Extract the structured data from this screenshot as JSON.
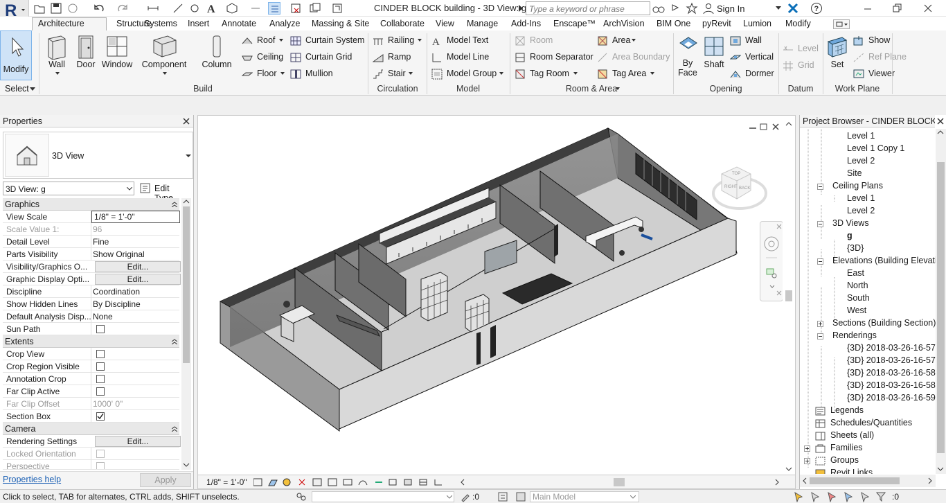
{
  "app": {
    "window_title": "CINDER BLOCK building - 3D View: g",
    "search_placeholder": "Type a keyword or phrase",
    "sign_in": "Sign In"
  },
  "tabs": [
    "Architecture",
    "Structure",
    "Systems",
    "Insert",
    "Annotate",
    "Analyze",
    "Massing & Site",
    "Collaborate",
    "View",
    "Manage",
    "Add-Ins",
    "Enscape™",
    "ArchVision",
    "BIM One",
    "pyRevit",
    "Lumion",
    "Modify"
  ],
  "ribbon": {
    "select": {
      "modify": "Modify",
      "select": "Select"
    },
    "build": {
      "panel": "Build",
      "wall": "Wall",
      "door": "Door",
      "window": "Window",
      "component": "Component",
      "column": "Column",
      "roof": "Roof",
      "ceiling": "Ceiling",
      "floor": "Floor",
      "curtain_system": "Curtain System",
      "curtain_grid": "Curtain Grid",
      "mullion": "Mullion"
    },
    "circulation": {
      "panel": "Circulation",
      "railing": "Railing",
      "ramp": "Ramp",
      "stair": "Stair"
    },
    "model": {
      "panel": "Model",
      "model_text": "Model Text",
      "model_line": "Model Line",
      "model_group": "Model Group"
    },
    "room_area": {
      "panel": "Room & Area",
      "room": "Room",
      "room_separator": "Room Separator",
      "tag_room": "Tag Room",
      "area": "Area",
      "area_boundary": "Area Boundary",
      "tag_area": "Tag Area"
    },
    "opening": {
      "panel": "Opening",
      "by_face_1": "By",
      "by_face_2": "Face",
      "shaft": "Shaft",
      "wall": "Wall",
      "vertical": "Vertical",
      "dormer": "Dormer"
    },
    "datum": {
      "panel": "Datum",
      "level": "Level",
      "grid": "Grid"
    },
    "work_plane": {
      "panel": "Work Plane",
      "set": "Set",
      "show": "Show",
      "ref_plane": "Ref Plane",
      "viewer": "Viewer"
    }
  },
  "properties": {
    "title": "Properties",
    "type_name": "3D View",
    "selector": "3D View: g",
    "edit_type": "Edit Type",
    "groups": {
      "graphics": "Graphics",
      "extents": "Extents",
      "camera": "Camera"
    },
    "rows": [
      {
        "k": "View Scale",
        "v": "1/8\" = 1'-0\""
      },
      {
        "k": "Scale Value    1:",
        "v": "96"
      },
      {
        "k": "Detail Level",
        "v": "Fine"
      },
      {
        "k": "Parts Visibility",
        "v": "Show Original"
      },
      {
        "k": "Visibility/Graphics O...",
        "v": "Edit..."
      },
      {
        "k": "Graphic Display Opti...",
        "v": "Edit..."
      },
      {
        "k": "Discipline",
        "v": "Coordination"
      },
      {
        "k": "Show Hidden Lines",
        "v": "By Discipline"
      },
      {
        "k": "Default Analysis Disp...",
        "v": "None"
      },
      {
        "k": "Sun Path",
        "v": ""
      },
      {
        "k": "Crop View",
        "v": ""
      },
      {
        "k": "Crop Region Visible",
        "v": ""
      },
      {
        "k": "Annotation Crop",
        "v": ""
      },
      {
        "k": "Far Clip Active",
        "v": ""
      },
      {
        "k": "Far Clip Offset",
        "v": "1000'  0\""
      },
      {
        "k": "Section Box",
        "v": ""
      },
      {
        "k": "Rendering Settings",
        "v": "Edit..."
      },
      {
        "k": "Locked Orientation",
        "v": ""
      },
      {
        "k": "Perspective",
        "v": ""
      }
    ],
    "help": "Properties help",
    "apply": "Apply"
  },
  "viewport": {
    "scale": "1/8\" = 1'-0\"",
    "viewcube_labels": [
      "TOP",
      "BACK",
      "RIGHT"
    ]
  },
  "browser": {
    "title": "Project Browser - CINDER BLOCK b...",
    "items": [
      "Level 1",
      "Level 1 Copy 1",
      "Level 2",
      "Site",
      "Ceiling Plans",
      "Level 1",
      "Level 2",
      "3D Views",
      "g",
      "{3D}",
      "Elevations (Building Elevatio",
      "East",
      "North",
      "South",
      "West",
      "Sections (Building Section)",
      "Renderings",
      "{3D} 2018-03-26-16-57",
      "{3D} 2018-03-26-16-57",
      "{3D} 2018-03-26-16-58",
      "{3D} 2018-03-26-16-58",
      "{3D} 2018-03-26-16-59",
      "Legends",
      "Schedules/Quantities",
      "Sheets (all)",
      "Families",
      "Groups",
      "Revit Links"
    ]
  },
  "status": {
    "hint": "Click to select, TAB for alternates, CTRL adds, SHIFT unselects.",
    "worksets": ":0",
    "model": "Main Model",
    "filter_count": ":0"
  }
}
